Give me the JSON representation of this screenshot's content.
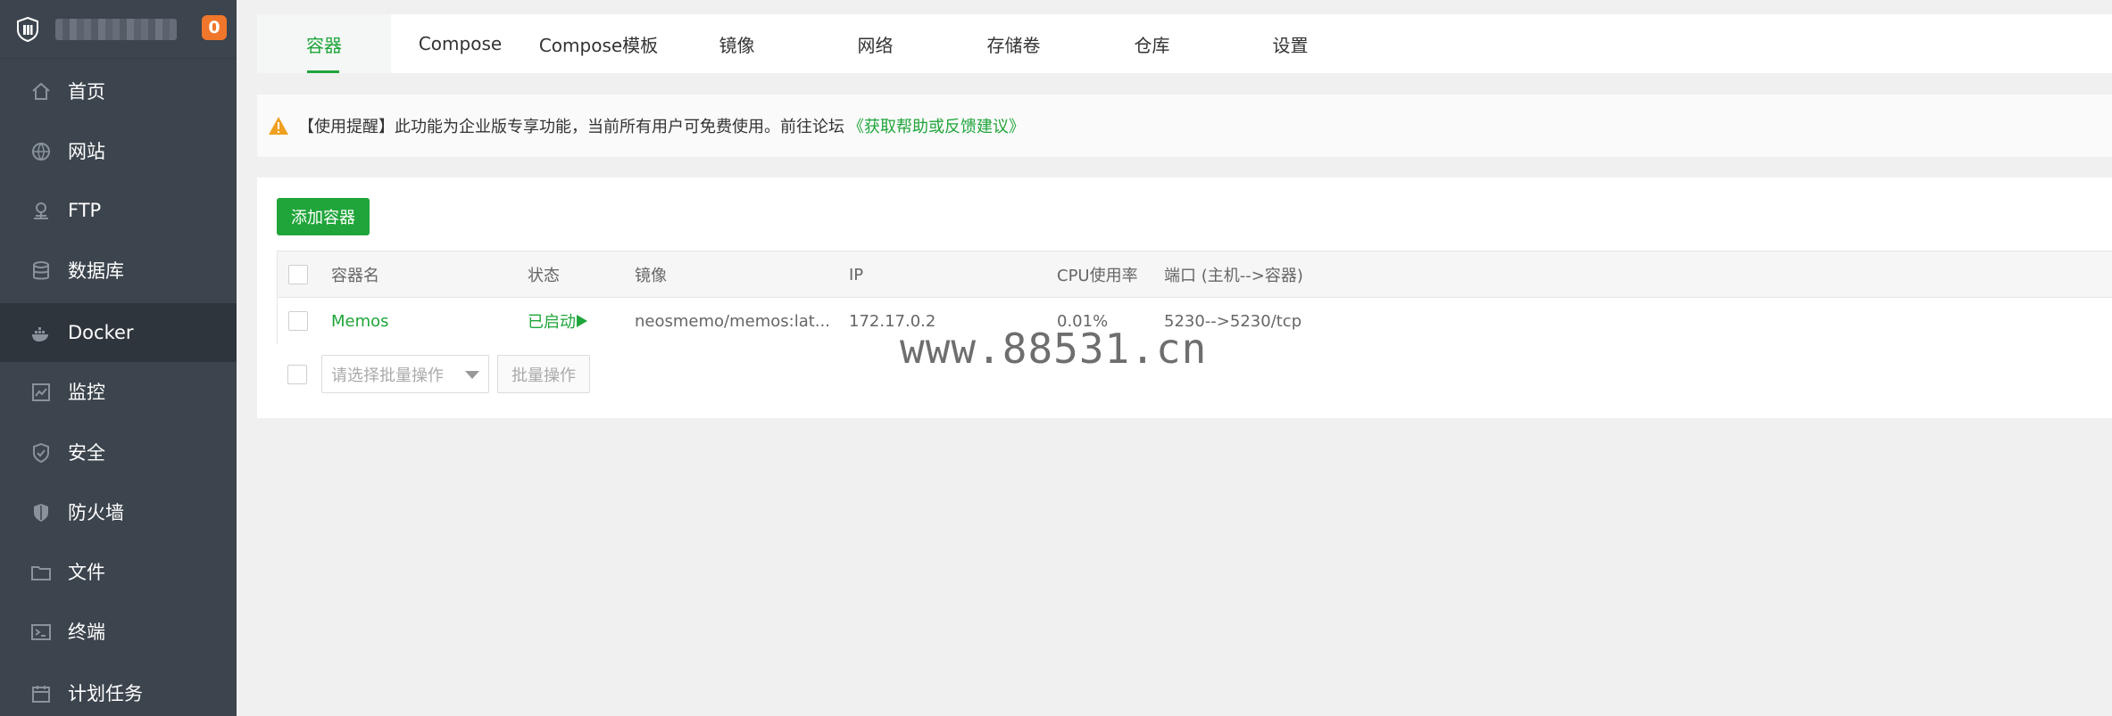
{
  "sidebar": {
    "notification_count": "0",
    "items": [
      {
        "label": "首页",
        "icon": "home-icon"
      },
      {
        "label": "网站",
        "icon": "globe-icon"
      },
      {
        "label": "FTP",
        "icon": "ftp-icon"
      },
      {
        "label": "数据库",
        "icon": "database-icon"
      },
      {
        "label": "Docker",
        "icon": "docker-icon",
        "active": true
      },
      {
        "label": "监控",
        "icon": "monitor-icon"
      },
      {
        "label": "安全",
        "icon": "shield-icon"
      },
      {
        "label": "防火墙",
        "icon": "firewall-icon"
      },
      {
        "label": "文件",
        "icon": "folder-icon"
      },
      {
        "label": "终端",
        "icon": "terminal-icon"
      },
      {
        "label": "计划任务",
        "icon": "calendar-icon"
      }
    ]
  },
  "tabs": [
    {
      "label": "容器",
      "active": true
    },
    {
      "label": "Compose"
    },
    {
      "label": "Compose模板"
    },
    {
      "label": "镜像"
    },
    {
      "label": "网络"
    },
    {
      "label": "存储卷"
    },
    {
      "label": "仓库"
    },
    {
      "label": "设置"
    }
  ],
  "notice": {
    "text": "【使用提醒】此功能为企业版专享功能，当前所有用户可免费使用。前往论坛",
    "link": "《获取帮助或反馈建议》"
  },
  "toolbar": {
    "add_label": "添加容器"
  },
  "table": {
    "headers": {
      "name": "容器名",
      "status": "状态",
      "image": "镜像",
      "ip": "IP",
      "cpu": "CPU使用率",
      "ports": "端口 (主机-->容器)"
    },
    "rows": [
      {
        "name": "Memos",
        "status": "已启动",
        "image": "neosmemo/memos:lat...",
        "ip": "172.17.0.2",
        "cpu": "0.01%",
        "ports": "5230-->5230/tcp"
      }
    ]
  },
  "batch": {
    "select_placeholder": "请选择批量操作",
    "button_label": "批量操作"
  },
  "watermark": "www.88531.cn",
  "colors": {
    "accent": "#20a53a",
    "sidebar_bg": "#3c444d",
    "badge": "#f0762b",
    "warning": "#f0a020"
  }
}
